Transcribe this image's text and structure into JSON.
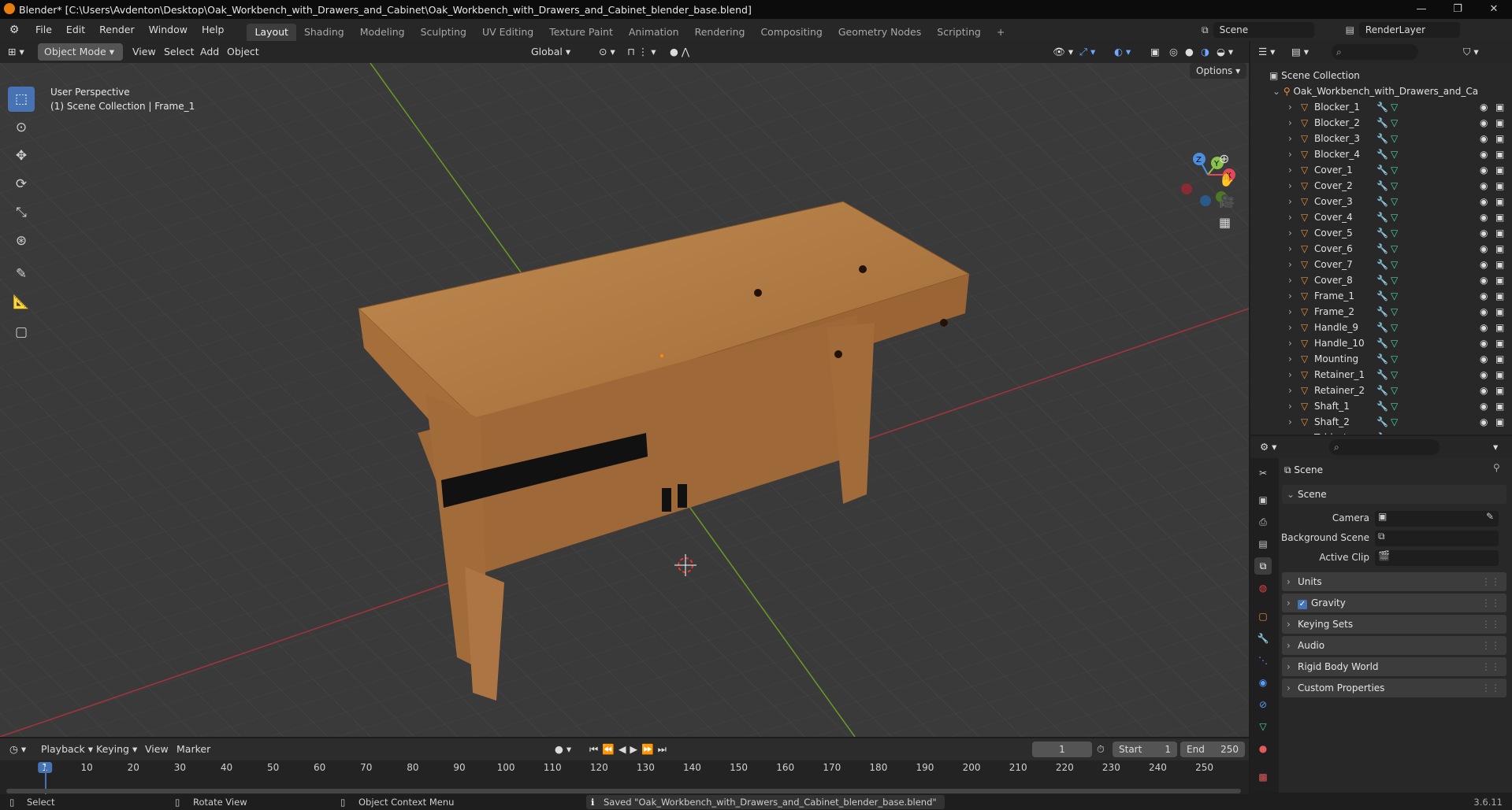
{
  "window": {
    "title": "Blender* [C:\\Users\\Avdenton\\Desktop\\Oak_Workbench_with_Drawers_and_Cabinet\\Oak_Workbench_with_Drawers_and_Cabinet_blender_base.blend]",
    "min": "—",
    "max": "❐",
    "close": "✕"
  },
  "menu": [
    "File",
    "Edit",
    "Render",
    "Window",
    "Help"
  ],
  "workspaces": [
    "Layout",
    "Shading",
    "Modeling",
    "Sculpting",
    "UV Editing",
    "Texture Paint",
    "Animation",
    "Rendering",
    "Compositing",
    "Geometry Nodes",
    "Scripting"
  ],
  "active_workspace": "Layout",
  "scene_selector": "Scene",
  "render_layer": "RenderLayer",
  "viewport_header": {
    "mode": "Object Mode",
    "menus": [
      "View",
      "Select",
      "Add",
      "Object"
    ],
    "orientation": "Global",
    "options": "Options"
  },
  "viewport": {
    "perspective": "User Perspective",
    "collection_info": "(1) Scene Collection | Frame_1",
    "gizmo_x": "X",
    "gizmo_y": "Y",
    "gizmo_z": "Z"
  },
  "outliner": {
    "root": "Scene Collection",
    "parent": "Oak_Workbench_with_Drawers_and_Ca",
    "items": [
      "Blocker_1",
      "Blocker_2",
      "Blocker_3",
      "Blocker_4",
      "Cover_1",
      "Cover_2",
      "Cover_3",
      "Cover_4",
      "Cover_5",
      "Cover_6",
      "Cover_7",
      "Cover_8",
      "Frame_1",
      "Frame_2",
      "Handle_9",
      "Handle_10",
      "Mounting",
      "Retainer_1",
      "Retainer_2",
      "Shaft_1",
      "Shaft_2",
      "Table_tops"
    ]
  },
  "properties": {
    "context": "Scene",
    "section": "Scene",
    "camera_label": "Camera",
    "bg_scene_label": "Background Scene",
    "active_clip_label": "Active Clip",
    "panels": [
      "Units",
      "Gravity",
      "Keying Sets",
      "Audio",
      "Rigid Body World",
      "Custom Properties"
    ],
    "gravity_checked": true
  },
  "timeline": {
    "menus": [
      "Playback",
      "Keying",
      "View",
      "Marker"
    ],
    "current_frame": "1",
    "start_label": "Start",
    "start": "1",
    "end_label": "End",
    "end": "250",
    "ticks": [
      "1",
      "10",
      "20",
      "30",
      "40",
      "50",
      "60",
      "70",
      "80",
      "90",
      "100",
      "110",
      "120",
      "130",
      "140",
      "150",
      "160",
      "170",
      "180",
      "190",
      "200",
      "210",
      "220",
      "230",
      "240",
      "250"
    ]
  },
  "status": {
    "select": "Select",
    "rotate": "Rotate View",
    "context_menu": "Object Context Menu",
    "message": "Saved \"Oak_Workbench_with_Drawers_and_Cabinet_blender_base.blend\"",
    "version": "3.6.11"
  },
  "colors": {
    "accent": "#4772b3",
    "axis_x": "#e2485a",
    "axis_y": "#8bc34a",
    "axis_z": "#4a90e2",
    "object_icon": "#e8913b",
    "mesh_icon": "#4fd1a4",
    "wood": "#b07843"
  }
}
